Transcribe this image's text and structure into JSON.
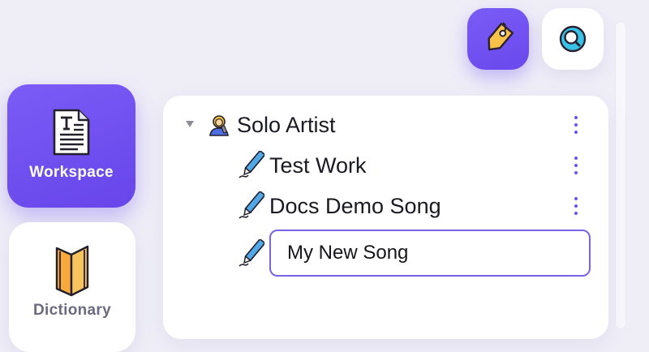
{
  "toolbar": {
    "tag_icon": "tag-icon",
    "search_icon": "search-icon"
  },
  "nav": {
    "workspace": {
      "label": "Workspace",
      "icon": "document-icon"
    },
    "dictionary": {
      "label": "Dictionary",
      "icon": "book-icon"
    }
  },
  "tree": {
    "root": {
      "label": "Solo Artist",
      "icon": "artist-icon",
      "expanded": true
    },
    "children": [
      {
        "label": "Test Work",
        "icon": "pen-icon"
      },
      {
        "label": "Docs Demo Song",
        "icon": "pen-icon"
      }
    ],
    "new_item": {
      "icon": "pen-icon",
      "value": "My New Song"
    }
  },
  "colors": {
    "accent": "#6a48ec",
    "background": "#efeef7",
    "text": "#1a1a22"
  }
}
